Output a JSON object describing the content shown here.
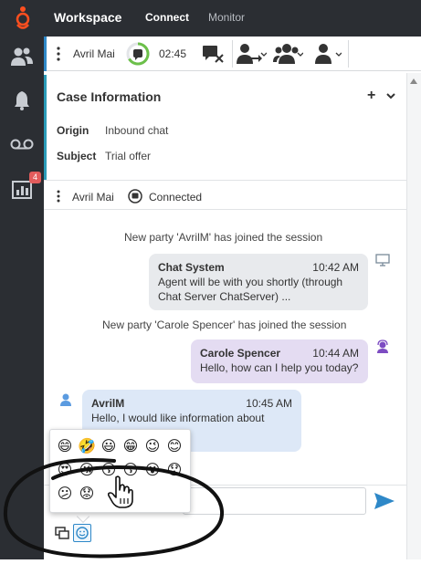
{
  "app": {
    "title": "Workspace",
    "tabs": [
      {
        "label": "Connect",
        "active": true
      },
      {
        "label": "Monitor",
        "active": false
      }
    ],
    "brand_color": "#ff4f1f"
  },
  "sidebar": {
    "items": [
      {
        "icon": "contacts-icon"
      },
      {
        "icon": "notifications-bell-icon"
      },
      {
        "icon": "voicemail-icon"
      },
      {
        "icon": "statistics-icon",
        "badge": "4"
      }
    ]
  },
  "toolbar": {
    "party_name": "Avril Mai",
    "timer": "02:45",
    "icons": [
      "more-vertical-icon",
      "chat-timer-icon",
      "end-chat-icon",
      "transfer-icon",
      "conference-icon",
      "consult-icon"
    ]
  },
  "case": {
    "title": "Case Information",
    "fields": [
      {
        "key": "Origin",
        "value": "Inbound chat"
      },
      {
        "key": "Subject",
        "value": "Trial offer"
      }
    ]
  },
  "status": {
    "party": "Avril Mai",
    "state": "Connected"
  },
  "transcript": {
    "events": [
      "New party 'AvrilM' has joined the session",
      "New party 'Carole Spencer' has joined the session"
    ],
    "messages": [
      {
        "sender": "Chat System",
        "time": "10:42 AM",
        "text": "Agent will be with you shortly (through Chat Server ChatServer) ..."
      },
      {
        "sender": "Carole Spencer",
        "time": "10:44 AM",
        "text": "Hello, how can I help you today?"
      },
      {
        "sender": "AvrilM",
        "time": "10:45 AM",
        "text": "Hello, I would like information about"
      }
    ]
  },
  "emoji_picker": {
    "rows": [
      [
        "😄",
        "🤣",
        "😃",
        "😁",
        "😉",
        "😊"
      ],
      [
        "😍",
        "😘",
        "😗",
        "😚",
        "😮",
        "😯"
      ],
      [
        "😕",
        "😟"
      ]
    ]
  },
  "input": {
    "value": "",
    "placeholder": ""
  },
  "colors": {
    "accent": "#2e88c8",
    "agent_bubble": "#e4dcf2",
    "customer_bubble": "#dde8f7",
    "system_bubble": "#e8eaed"
  }
}
